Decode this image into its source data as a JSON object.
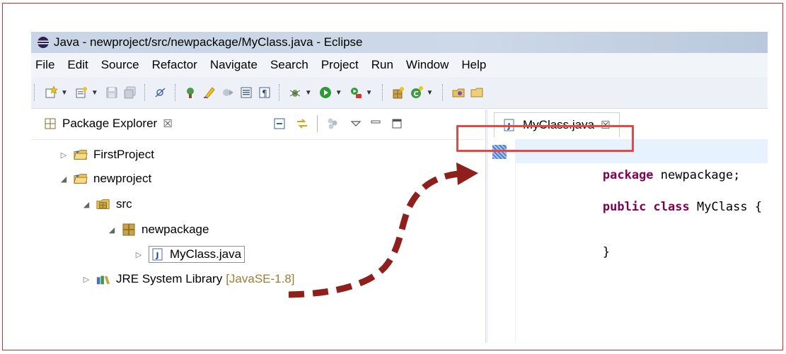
{
  "window": {
    "title": "Java - newproject/src/newpackage/MyClass.java - Eclipse"
  },
  "menu": [
    "File",
    "Edit",
    "Source",
    "Refactor",
    "Navigate",
    "Search",
    "Project",
    "Run",
    "Window",
    "Help"
  ],
  "toolbar": {
    "icons": [
      "new-wizard-icon",
      "new-type-icon",
      "save-icon",
      "save-all-icon",
      "skip-breakpoints-icon",
      "new-java-project-icon",
      "highlight-icon",
      "toggle-mark-icon",
      "word-wrap-icon",
      "show-whitespace-icon",
      "debug-icon",
      "run-icon",
      "external-tools-icon",
      "new-package-icon",
      "new-class-icon",
      "open-type-icon",
      "open-folder-icon"
    ]
  },
  "package_explorer": {
    "title": "Package Explorer",
    "close_glyph": "☒",
    "tree": {
      "first_project": "FirstProject",
      "new_project": "newproject",
      "src": "src",
      "package": "newpackage",
      "file": "MyClass.java",
      "jre": "JRE System Library",
      "jre_version": "[JavaSE-1.8]"
    }
  },
  "editor": {
    "tab_label": "MyClass.java",
    "close_glyph": "☒",
    "code": {
      "line1_kw": "package",
      "line1_rest": " newpackage;",
      "line2_kw": "public class",
      "line2_rest": " MyClass {",
      "line3": "}"
    }
  },
  "colors": {
    "annotation_red": "#e34a45",
    "arrow_dark_red": "#8e1f1b",
    "keyword": "#7f0055"
  }
}
